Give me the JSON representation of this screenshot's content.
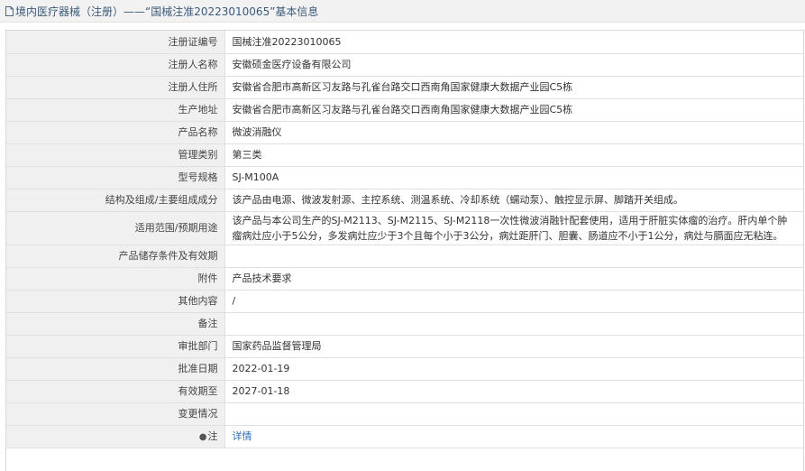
{
  "header": {
    "title": "境内医疗器械（注册）——“国械注准20223010065”基本信息"
  },
  "rows": [
    {
      "label": "注册证编号",
      "value": "国械注准20223010065"
    },
    {
      "label": "注册人名称",
      "value": "安徽硕金医疗设备有限公司"
    },
    {
      "label": "注册人住所",
      "value": "安徽省合肥市高新区习友路与孔雀台路交口西南角国家健康大数据产业园C5栋"
    },
    {
      "label": "生产地址",
      "value": "安徽省合肥市高新区习友路与孔雀台路交口西南角国家健康大数据产业园C5栋"
    },
    {
      "label": "产品名称",
      "value": "微波消融仪"
    },
    {
      "label": "管理类别",
      "value": "第三类"
    },
    {
      "label": "型号规格",
      "value": "SJ-M100A"
    },
    {
      "label": "结构及组成/主要组成成分",
      "value": "该产品由电源、微波发射源、主控系统、测温系统、冷却系统（蠕动泵）、触控显示屏、脚踏开关组成。"
    },
    {
      "label": "适用范围/预期用途",
      "value": "该产品与本公司生产的SJ-M2113、SJ-M2115、SJ-M2118一次性微波消融针配套使用，适用于肝脏实体瘤的治疗。肝内单个肿瘤病灶应小于5公分，多发病灶应少于3个且每个小于3公分，病灶距肝门、胆囊、肠道应不小于1公分，病灶与膈面应无粘连。"
    },
    {
      "label": "产品储存条件及有效期",
      "value": ""
    },
    {
      "label": "附件",
      "value": "产品技术要求"
    },
    {
      "label": "其他内容",
      "value": "/"
    },
    {
      "label": "备注",
      "value": ""
    },
    {
      "label": "审批部门",
      "value": "国家药品监督管理局"
    },
    {
      "label": "批准日期",
      "value": "2022-01-19"
    },
    {
      "label": "有效期至",
      "value": "2027-01-18"
    },
    {
      "label": "变更情况",
      "value": ""
    },
    {
      "label": "注",
      "value": "详情"
    }
  ],
  "icons": {
    "header": "document-icon",
    "note": "pin-icon"
  }
}
